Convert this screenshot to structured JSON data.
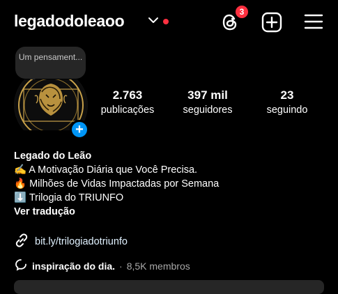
{
  "header": {
    "username": "legadodoleaoo",
    "threads_badge": "3"
  },
  "note": {
    "text": "Um pensament..."
  },
  "stats": [
    {
      "value": "2.763",
      "label": "publicações"
    },
    {
      "value": "397 mil",
      "label": "seguidores"
    },
    {
      "value": "23",
      "label": "seguindo"
    }
  ],
  "bio": {
    "name": "Legado do Leão",
    "lines": [
      "✍️ A Motivação Diária que Você Precisa.",
      "🔥 Milhões de Vidas Impactadas por Semana",
      "⬇️ Trilogia do TRIUNFO"
    ],
    "translate": "Ver tradução"
  },
  "link": {
    "text": "bit.ly/trilogiadotriunfo"
  },
  "channel": {
    "name": "inspiração do dia.",
    "separator": "·",
    "members": "8,5K membros"
  },
  "colors": {
    "background": "#000000",
    "accent_blue": "#0095f6",
    "badge_red": "#ff3040",
    "gold": "#c9a24a"
  }
}
